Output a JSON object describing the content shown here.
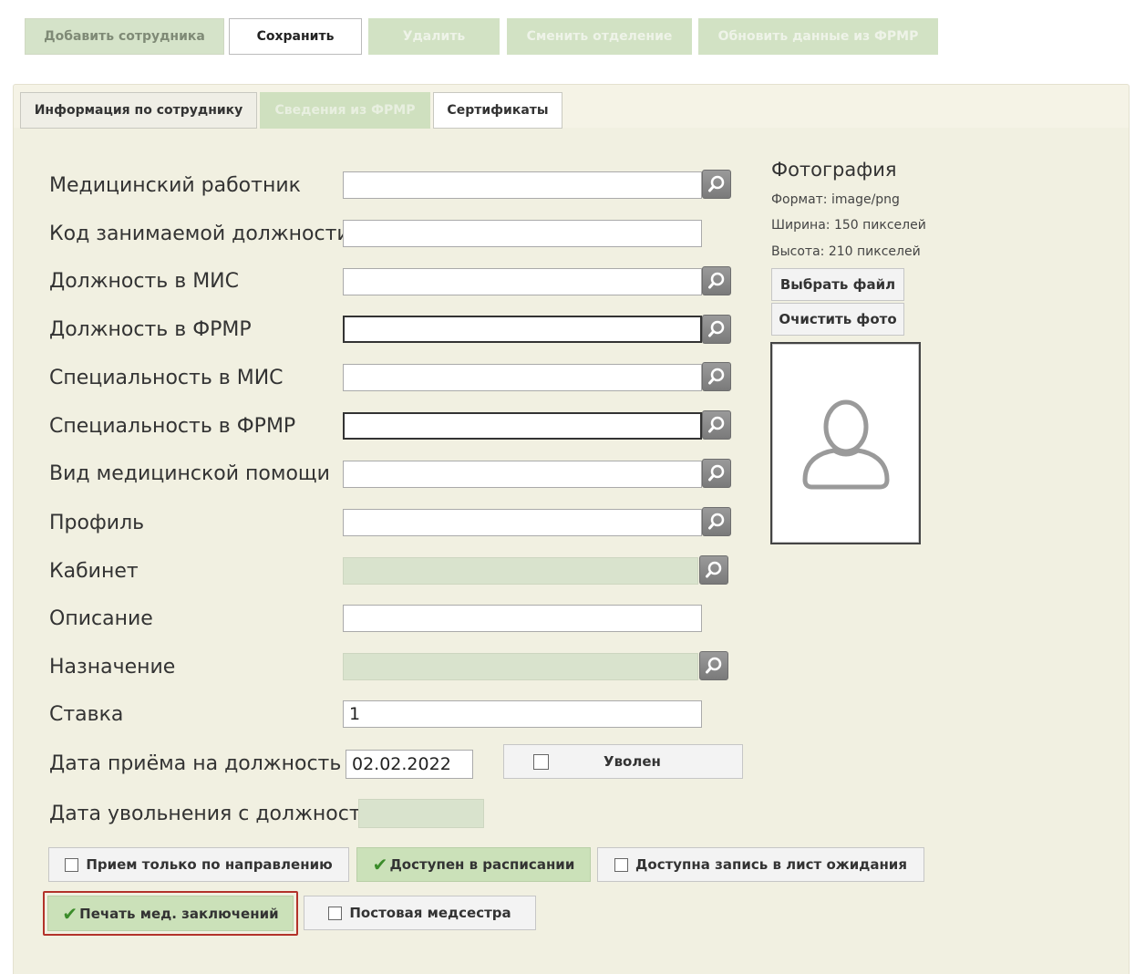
{
  "toolbar": {
    "add_employee": "Добавить сотрудника",
    "save": "Сохранить",
    "delete": "Удалить",
    "change_department": "Сменить отделение",
    "update_frmr": "Обновить данные из ФРМР"
  },
  "tabs": [
    {
      "label": "Информация по сотруднику",
      "state": "selected"
    },
    {
      "label": "Сведения из ФРМР",
      "state": "disabled"
    },
    {
      "label": "Сертификаты",
      "state": "normal"
    }
  ],
  "form": {
    "medical_worker": {
      "label": "Медицинский работник",
      "value": ""
    },
    "position_code": {
      "label": "Код занимаемой должности",
      "value": ""
    },
    "position_mis": {
      "label": "Должность в МИС",
      "value": ""
    },
    "position_frmr": {
      "label": "Должность в ФРМР",
      "value": ""
    },
    "specialty_mis": {
      "label": "Специальность в МИС",
      "value": ""
    },
    "specialty_frmr": {
      "label": "Специальность в ФРМР",
      "value": ""
    },
    "care_type": {
      "label": "Вид медицинской помощи",
      "value": ""
    },
    "profile": {
      "label": "Профиль",
      "value": ""
    },
    "cabinet": {
      "label": "Кабинет",
      "value": ""
    },
    "description": {
      "label": "Описание",
      "value": ""
    },
    "assignment": {
      "label": "Назначение",
      "value": ""
    },
    "rate": {
      "label": "Ставка",
      "value": "1"
    },
    "hire_date": {
      "label": "Дата приёма на должность",
      "value": "02.02.2022"
    },
    "dismissal_date": {
      "label": "Дата увольнения с должности",
      "value": ""
    }
  },
  "dismissed": {
    "label": "Уволен",
    "checked": false
  },
  "photo": {
    "title": "Фотография",
    "format": "Формат: image/png",
    "width": "Ширина: 150 пикселей",
    "height": "Высота: 210 пикселей",
    "choose_file": "Выбрать файл",
    "clear_photo": "Очистить фото"
  },
  "options": {
    "referral_only": {
      "label": "Прием только по направлению",
      "checked": false
    },
    "in_schedule": {
      "label": "Доступен в расписании",
      "checked": true
    },
    "waiting_list": {
      "label": "Доступна запись в лист ожидания",
      "checked": false
    },
    "print_med_reports": {
      "label": "Печать мед. заключений",
      "checked": true
    },
    "ward_nurse": {
      "label": "Постовая медсестра",
      "checked": false
    }
  },
  "colors": {
    "green_button": "#cbe1b9",
    "highlight_border": "#b3322a",
    "panel_bg": "#f1f0e1"
  }
}
